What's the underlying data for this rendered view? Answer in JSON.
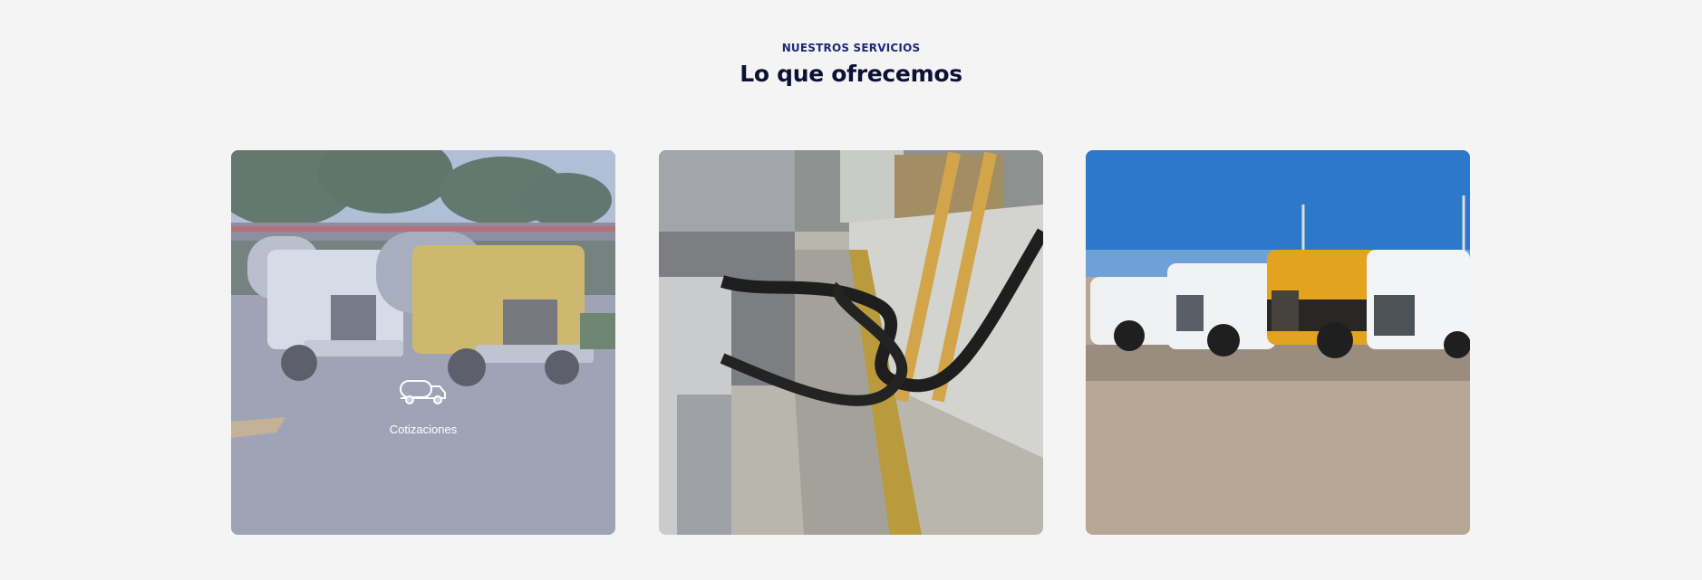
{
  "section": {
    "eyebrow": "NUESTROS SERVICIOS",
    "title": "Lo que ofrecemos"
  },
  "cards": [
    {
      "label": "Cotizaciones",
      "icon": "tanker-truck-icon",
      "image": "tanker-trucks-at-gas-station"
    },
    {
      "label": "",
      "icon": "",
      "image": "tanker-hose-unloading"
    },
    {
      "label": "",
      "icon": "",
      "image": "tanker-fleet-parked-lot"
    }
  ],
  "colors": {
    "background": "#f4f4f4",
    "eyebrow": "#1f2a7a",
    "title": "#0c1236",
    "overlay": "#bec6e0"
  }
}
